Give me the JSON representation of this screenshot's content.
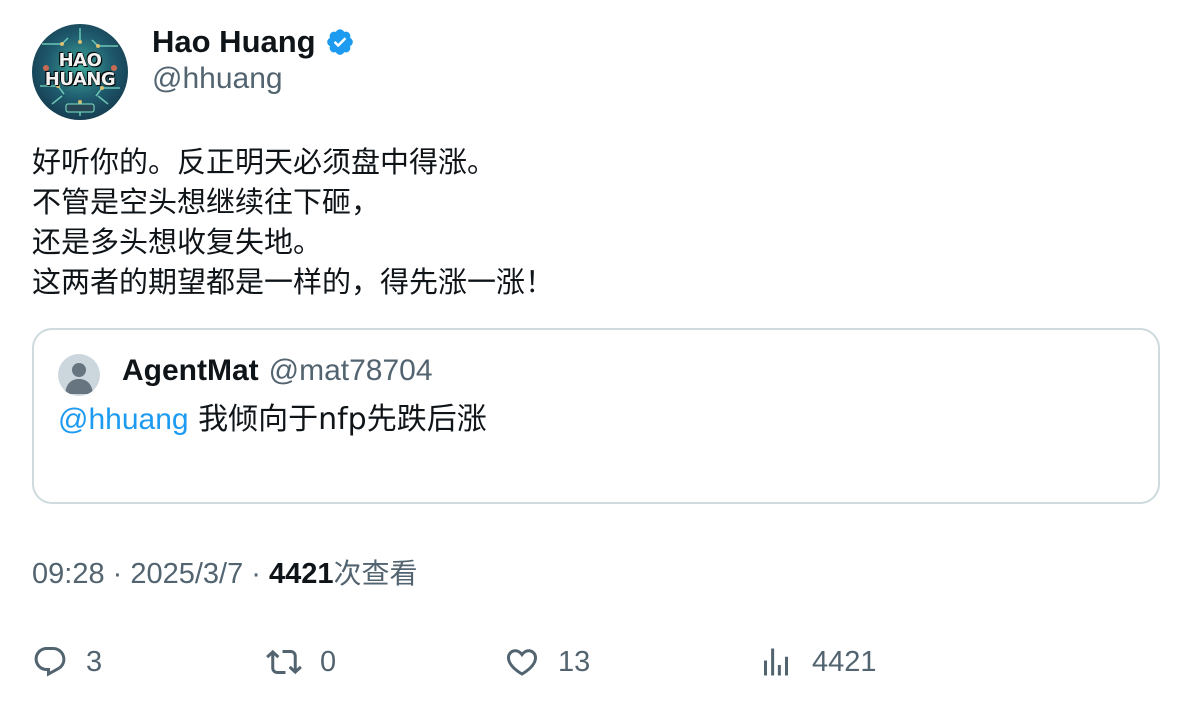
{
  "author": {
    "display_name": "Hao Huang",
    "handle": "@hhuang",
    "avatar_text": [
      "HAO",
      "HUANG"
    ],
    "verified": true
  },
  "tweet": {
    "lines": [
      "好听你的。反正明天必须盘中得涨。",
      "不管是空头想继续往下砸，",
      "还是多头想收复失地。",
      "这两者的期望都是一样的，得先涨一涨！"
    ]
  },
  "quoted_tweet": {
    "display_name": "AgentMat",
    "handle": "@mat78704",
    "mention": "@hhuang",
    "text": " 我倾向于nfp先跌后涨"
  },
  "meta": {
    "time": "09:28",
    "separator": " · ",
    "date": "2025/3/7",
    "views_count": "4421",
    "views_label": "次查看"
  },
  "actions": {
    "replies": "3",
    "retweets": "0",
    "likes": "13",
    "views": "4421"
  },
  "colors": {
    "verified": "#1d9bf0",
    "mention": "#1d9bf0",
    "secondary_text": "#536471",
    "border": "#cfd9de"
  },
  "icons": [
    "verified-badge-icon",
    "reply-icon",
    "retweet-icon",
    "like-icon",
    "views-icon",
    "default-avatar-icon"
  ]
}
